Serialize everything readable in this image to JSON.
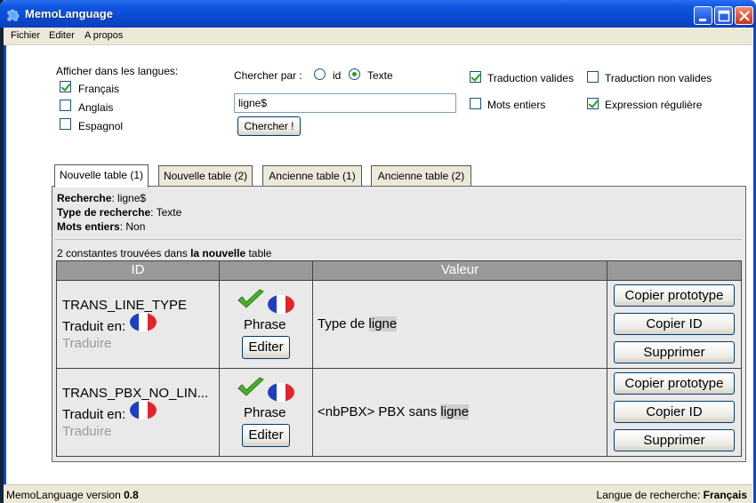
{
  "window": {
    "title": "MemoLanguage"
  },
  "menu": {
    "items": [
      "Fichier",
      "Editer",
      "A propos"
    ]
  },
  "languages": {
    "label": "Afficher dans les langues:",
    "options": [
      {
        "label": "Français",
        "checked": true
      },
      {
        "label": "Anglais",
        "checked": false
      },
      {
        "label": "Espagnol",
        "checked": false
      }
    ]
  },
  "search": {
    "by_label": "Chercher par :",
    "by_options": [
      {
        "label": "id",
        "selected": false
      },
      {
        "label": "Texte",
        "selected": true
      }
    ],
    "query": "ligne$",
    "button": "Chercher !"
  },
  "filters": [
    {
      "label": "Traduction valides",
      "checked": true
    },
    {
      "label": "Traduction non valides",
      "checked": false
    },
    {
      "label": "Mots entiers",
      "checked": false
    },
    {
      "label": "Expression régulière",
      "checked": true
    }
  ],
  "tabs": [
    {
      "label": "Nouvelle table (1)",
      "active": true
    },
    {
      "label": "Nouvelle table (2)",
      "active": false
    },
    {
      "label": "Ancienne table (1)",
      "active": false
    },
    {
      "label": "Ancienne table (2)",
      "active": false
    }
  ],
  "summary": {
    "recherche_key": "Recherche",
    "recherche_val": "ligne$",
    "type_key": "Type de recherche",
    "type_val": "Texte",
    "mots_key": "Mots entiers",
    "mots_val": "Non",
    "found_prefix": "2 constantes trouvées dans ",
    "found_bold": "la nouvelle",
    "found_suffix": " table"
  },
  "table": {
    "headers": [
      "ID",
      "",
      "Valeur",
      ""
    ],
    "rows": [
      {
        "id": "TRANS_LINE_TYPE",
        "translated_label": "Traduit en:",
        "translate_link": "Traduire",
        "kind": "Phrase",
        "edit_button": "Editer",
        "value_prefix": "Type de ",
        "value_match": "ligne",
        "value_suffix": "",
        "actions": [
          "Copier prototype",
          "Copier ID",
          "Supprimer"
        ]
      },
      {
        "id": "TRANS_PBX_NO_LIN...",
        "translated_label": "Traduit en:",
        "translate_link": "Traduire",
        "kind": "Phrase",
        "edit_button": "Editer",
        "value_prefix": "<nbPBX> PBX sans ",
        "value_match": "ligne",
        "value_suffix": "",
        "actions": [
          "Copier prototype",
          "Copier ID",
          "Supprimer"
        ]
      }
    ]
  },
  "status": {
    "version_label": "MemoLanguage version ",
    "version": "0.8",
    "lang_label": "Langue de recherche: ",
    "lang": "Français"
  },
  "colors": {
    "titlebar": "#0a48d0",
    "header": "#999999",
    "panel": "#e9e9e9",
    "check": "#21a121"
  }
}
